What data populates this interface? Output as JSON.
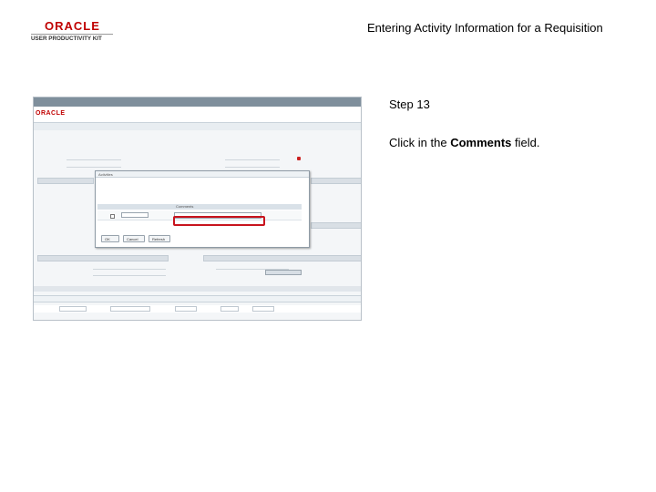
{
  "header": {
    "logo_brand": "ORACLE",
    "logo_product": "USER PRODUCTIVITY KIT",
    "title": "Entering Activity Information for a Requisition"
  },
  "step": {
    "title": "Step 13",
    "instruction_prefix": "Click in the ",
    "instruction_target": "Comments",
    "instruction_suffix": " field."
  },
  "app_screenshot": {
    "brand": "ORACLE",
    "modal": {
      "title": "Activities",
      "comments_label": "Comments",
      "comments_value": "",
      "ok_button": "OK",
      "cancel_button": "Cancel",
      "refresh_button": "Refresh"
    },
    "highlight_color": "#c8141e"
  }
}
